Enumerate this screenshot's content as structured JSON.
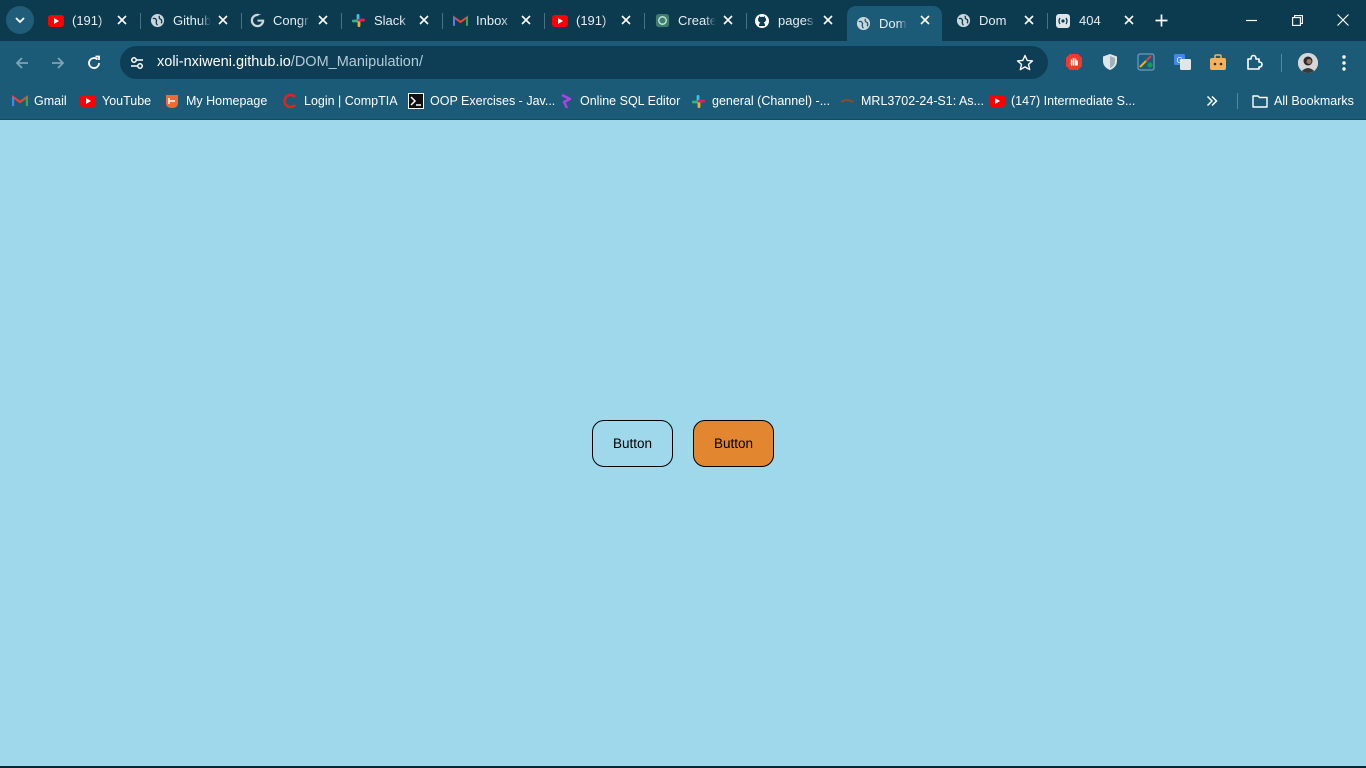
{
  "browser": {
    "tabs": [
      {
        "title": "(191)",
        "favicon": "youtube-icon"
      },
      {
        "title": "Github",
        "favicon": "globe-icon"
      },
      {
        "title": "Congr",
        "favicon": "google-icon"
      },
      {
        "title": "Slack",
        "favicon": "slack-icon"
      },
      {
        "title": "Inbox",
        "favicon": "gmail-icon"
      },
      {
        "title": "(191)",
        "favicon": "youtube-icon"
      },
      {
        "title": "Create",
        "favicon": "openai-icon"
      },
      {
        "title": "pages",
        "favicon": "github-icon"
      },
      {
        "title": "Dom",
        "favicon": "globe-icon",
        "active": true
      },
      {
        "title": "Dom",
        "favicon": "globe-icon"
      },
      {
        "title": "404",
        "favicon": "broadcast-icon"
      }
    ],
    "url_domain": "xoli-nxiweni.github.io",
    "url_path": "/DOM_Manipulation/",
    "bookmarks": [
      {
        "label": "Gmail",
        "icon": "gmail-icon"
      },
      {
        "label": "YouTube",
        "icon": "youtube-icon"
      },
      {
        "label": "My Homepage",
        "icon": "homepage-icon"
      },
      {
        "label": "Login | CompTIA",
        "icon": "comptia-icon"
      },
      {
        "label": "OOP Exercises - Jav...",
        "icon": "terminal-icon"
      },
      {
        "label": "Online SQL Editor",
        "icon": "sql-editor-icon"
      },
      {
        "label": "general (Channel) -...",
        "icon": "slack-icon"
      },
      {
        "label": "MRL3702-24-S1: As...",
        "icon": "unisa-icon"
      },
      {
        "label": "(147) Intermediate S...",
        "icon": "youtube-icon"
      }
    ],
    "all_bookmarks_label": "All Bookmarks"
  },
  "page": {
    "button1_label": "Button",
    "button2_label": "Button",
    "background_color": "#a0d8eb",
    "button2_color": "#e2862f"
  }
}
